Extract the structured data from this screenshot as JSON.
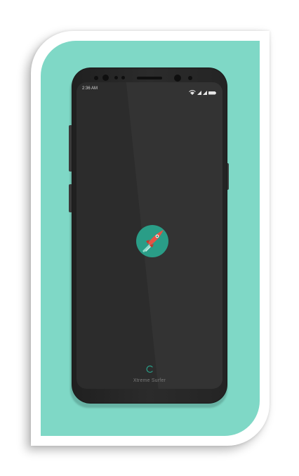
{
  "status_bar": {
    "time": "2:36 AM",
    "icons": [
      "wifi-icon",
      "signal-icon",
      "signal-icon",
      "battery-icon"
    ]
  },
  "splash": {
    "logo_icon": "rocket-icon",
    "loader_icon": "spinner-icon",
    "app_name": "Xtreme Surfer"
  },
  "colors": {
    "background_accent": "#7fd8c6",
    "logo_circle": "#2a9d87",
    "rocket": "#e85244",
    "loader": "#2a9d87"
  }
}
